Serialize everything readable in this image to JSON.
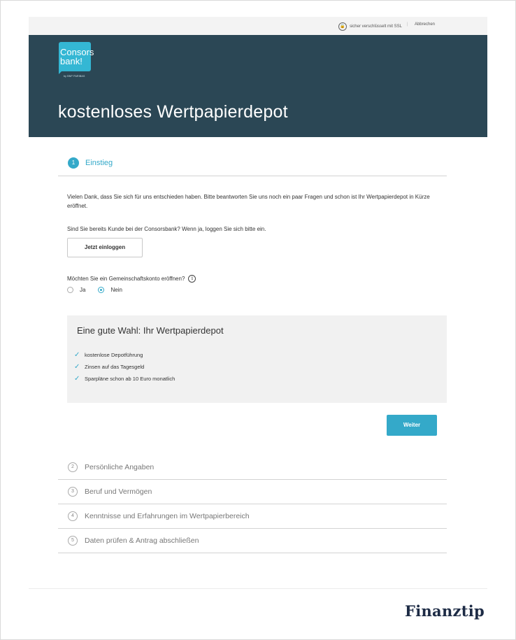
{
  "topbar": {
    "ssl_text": "sicher verschlüsselt mit SSL",
    "separator": "|",
    "cancel_label": "Abbrechen"
  },
  "header": {
    "logo_line1": "Consors",
    "logo_line2": "bank!",
    "logo_sub": "by BNP PARIBAS",
    "title": "kostenloses Wertpapierdepot"
  },
  "step_active": {
    "number": "1",
    "label": "Einstieg"
  },
  "content": {
    "intro": "Vielen Dank, dass Sie sich für uns entschieden haben. Bitte beantworten Sie uns noch ein paar Fragen und schon ist Ihr Wertpapierdepot in Kürze eröffnet.",
    "customer_question": "Sind Sie bereits Kunde bei der Consorsbank? Wenn ja, loggen Sie sich bitte ein.",
    "login_button": "Jetzt einloggen",
    "joint_account_question": "Möchten Sie ein Gemeinschaftskonto eröffnen?",
    "info_icon_glyph": "i",
    "options": [
      {
        "label": "Ja",
        "selected": false
      },
      {
        "label": "Nein",
        "selected": true
      }
    ]
  },
  "benefits": {
    "title": "Eine gute Wahl: Ihr Wertpapierdepot",
    "items": [
      "kostenlose Depotführung",
      "Zinsen auf das Tagesgeld",
      "Sparpläne schon ab 10 Euro monatlich"
    ],
    "check_glyph": "✓"
  },
  "next_button": "Weiter",
  "steps": [
    {
      "number": "2",
      "label": "Persönliche Angaben"
    },
    {
      "number": "3",
      "label": "Beruf und Vermögen"
    },
    {
      "number": "4",
      "label": "Kenntnisse und Erfahrungen im Wertpapierbereich"
    },
    {
      "number": "5",
      "label": "Daten prüfen & Antrag abschließen"
    }
  ],
  "footer": {
    "brand": "Finanztip"
  },
  "colors": {
    "header_bg": "#2b4755",
    "accent": "#34a9c9",
    "logo_bg": "#34b7d4",
    "panel_bg": "#f1f1f1"
  }
}
